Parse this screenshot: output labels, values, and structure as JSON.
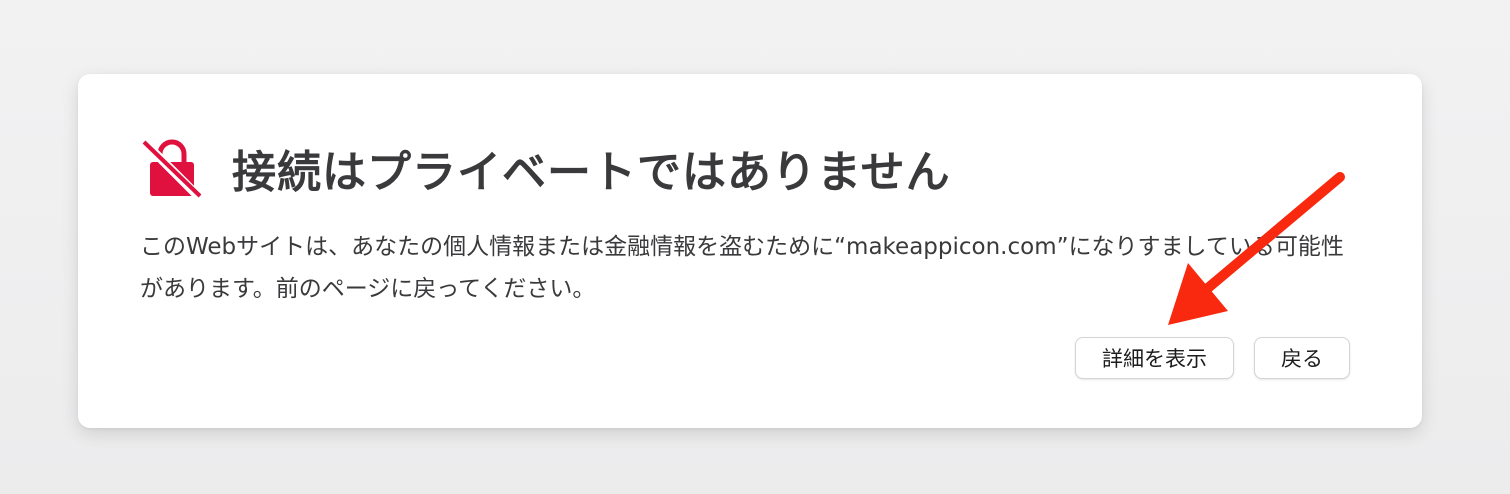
{
  "dialog": {
    "title": "接続はプライベートではありません",
    "message": "このWebサイトは、あなたの個人情報または金融情報を盗むために“makeappicon.com”になりすましている可能性があります。前のページに戻ってください。",
    "buttons": {
      "details_label": "詳細を表示",
      "back_label": "戻る"
    }
  },
  "icons": {
    "warning": "broken-lock-icon",
    "annotation": "red-arrow-icon"
  },
  "colors": {
    "warning_red": "#e0103f",
    "arrow_red": "#f8290f"
  }
}
